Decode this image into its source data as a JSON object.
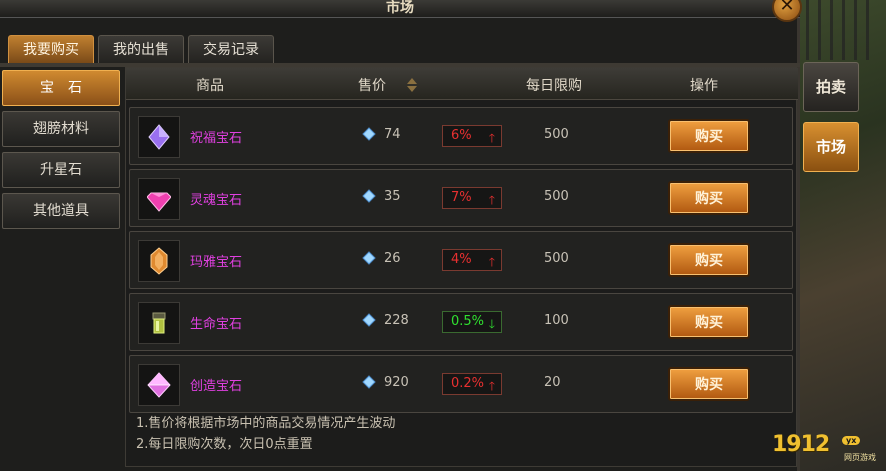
{
  "window": {
    "title": "市场",
    "close_label": "✕"
  },
  "tabs": [
    {
      "label": "我要购买",
      "active": true
    },
    {
      "label": "我的出售",
      "active": false
    },
    {
      "label": "交易记录",
      "active": false
    }
  ],
  "sidebar": [
    {
      "label": "宝　石",
      "active": true
    },
    {
      "label": "翅膀材料",
      "active": false
    },
    {
      "label": "升星石",
      "active": false
    },
    {
      "label": "其他道具",
      "active": false
    }
  ],
  "header": {
    "item": "商品",
    "price": "售价",
    "limit": "每日限购",
    "action": "操作"
  },
  "rows": [
    {
      "name": "祝福宝石",
      "icon": "purple-gem-icon",
      "price": "74",
      "change": "6%",
      "trend": "up",
      "limit": "500",
      "buy": "购买"
    },
    {
      "name": "灵魂宝石",
      "icon": "pink-gem-icon",
      "price": "35",
      "change": "7%",
      "trend": "up",
      "limit": "500",
      "buy": "购买"
    },
    {
      "name": "玛雅宝石",
      "icon": "orange-gem-icon",
      "price": "26",
      "change": "4%",
      "trend": "up",
      "limit": "500",
      "buy": "购买"
    },
    {
      "name": "生命宝石",
      "icon": "green-gem-icon",
      "price": "228",
      "change": "0.5%",
      "trend": "down",
      "limit": "100",
      "buy": "购买"
    },
    {
      "name": "创造宝石",
      "icon": "pink-crystal-icon",
      "price": "920",
      "change": "0.2%",
      "trend": "up",
      "limit": "20",
      "buy": "购买"
    }
  ],
  "notes": [
    "1.售价将根据市场中的商品交易情况产生波动",
    "2.每日限购次数，次日0点重置"
  ],
  "right_buttons": [
    {
      "label": "拍卖",
      "active": false
    },
    {
      "label": "市场",
      "active": true
    }
  ],
  "logo": {
    "text": "1912",
    "badge": "yx",
    "sub": "网页游戏"
  },
  "colors": {
    "accent": "#d08a30",
    "item_name": "#e040e0",
    "up": "#e83030",
    "down": "#30e030"
  }
}
